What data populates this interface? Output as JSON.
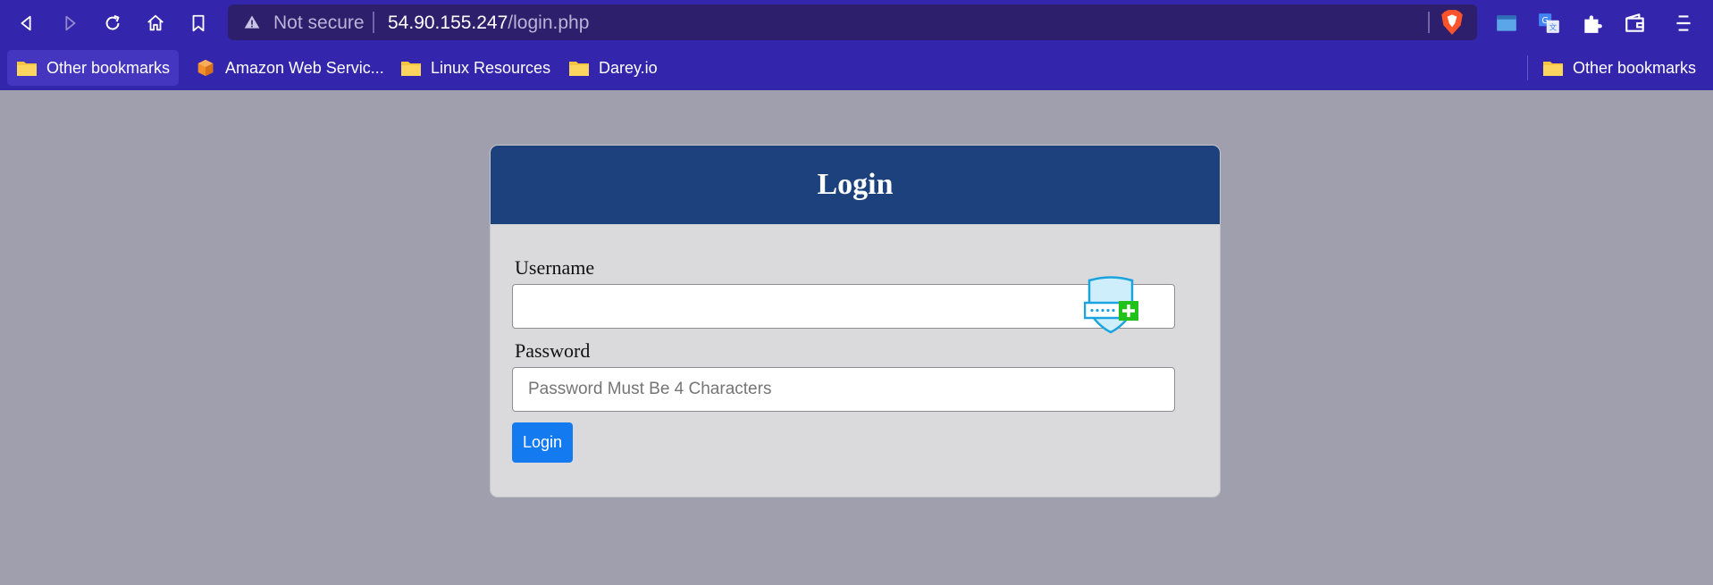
{
  "browser": {
    "url_warning": "Not secure",
    "url_host": "54.90.155.247",
    "url_path": "/login.php",
    "icons": [
      "back-icon",
      "forward-icon",
      "reload-icon",
      "home-icon",
      "bookmark-icon",
      "warning-icon",
      "brave-shield-icon",
      "window-icon",
      "translate-icon",
      "puzzle-icon",
      "wallet-icon",
      "menu-icon"
    ],
    "accent": "#3325ac"
  },
  "bookmarks": {
    "items": [
      {
        "label": "Other bookmarks",
        "icon": "folder-icon"
      },
      {
        "label": "Amazon Web Servic...",
        "icon": "aws-cube-icon"
      },
      {
        "label": "Linux Resources",
        "icon": "folder-icon"
      },
      {
        "label": "Darey.io",
        "icon": "folder-icon"
      }
    ],
    "right_item": "Other bookmarks"
  },
  "login": {
    "title": "Login",
    "username_label": "Username",
    "username_value": "",
    "password_label": "Password",
    "password_placeholder": "Password Must Be 4 Characters",
    "submit_label": "Login",
    "header_color": "#1c417c",
    "button_color": "#137bef"
  }
}
